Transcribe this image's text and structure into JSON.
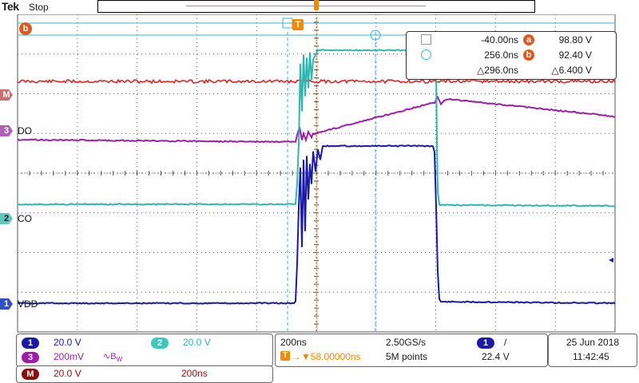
{
  "header": {
    "brand": "Tek",
    "status": "Stop"
  },
  "colors": {
    "ch1": "#1a1aa8",
    "ch2": "#2bb8b0",
    "ch3": "#a01ca8",
    "math": "#e32222",
    "accent": "#f08a00",
    "cursor": "#32b8d8"
  },
  "markers": {
    "cursor_b_tag": "b",
    "trigger_tag": "T",
    "math_tag": "M",
    "ch3_tag": "3",
    "ch2_tag": "2",
    "ch1_tag": "1"
  },
  "channel_labels": {
    "ch3": "DO",
    "ch2": "CO",
    "ch1": "VDD"
  },
  "cursor_readout": {
    "time_a": "-40.00ns",
    "volt_a_label": "a",
    "volt_a": "98.80 V",
    "time_b": "256.0ns",
    "volt_b_label": "b",
    "volt_b": "92.40 V",
    "delta_time": "△296.0ns",
    "delta_volt": "△6.400 V"
  },
  "vertical_panel": {
    "ch1_num": "1",
    "ch1_scale": "20.0 V",
    "ch2_num": "2",
    "ch2_scale": "20.0 V",
    "ch3_num": "3",
    "ch3_scale": "200mV",
    "ch3_bw": "∿B",
    "bw_sub": "W",
    "math_tag": "M",
    "math_scale": "20.0 V",
    "math_time": "200ns"
  },
  "horizontal_panel": {
    "time_div": "200ns",
    "sample_rate": "2.50GS/s",
    "trigger_pos": "→▼58.00000ns",
    "record_len": "5M points"
  },
  "trigger_panel": {
    "source": "1",
    "slope": "/",
    "level": "22.4 V"
  },
  "datetime": {
    "date": "25 Jun  2018",
    "time": "11:42:45"
  }
}
